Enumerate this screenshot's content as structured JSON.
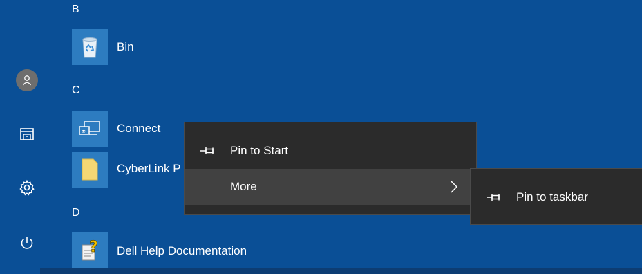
{
  "rail": {
    "items": [
      {
        "name": "user-icon"
      },
      {
        "name": "file-explorer-icon"
      },
      {
        "name": "settings-gear-icon"
      },
      {
        "name": "power-icon"
      }
    ]
  },
  "sections": {
    "b": "B",
    "c": "C",
    "d": "D"
  },
  "apps": {
    "bin": "Bin",
    "connect": "Connect",
    "cyberlink": "CyberLink P",
    "dell_help": "Dell Help Documentation"
  },
  "context_menu": {
    "pin_to_start": "Pin to Start",
    "more": "More"
  },
  "submenu": {
    "pin_to_taskbar": "Pin to taskbar"
  },
  "colors": {
    "background": "#0a4f96",
    "tile": "#2d7cc0",
    "menu": "#2b2b2b",
    "menu_hover": "#414141"
  }
}
